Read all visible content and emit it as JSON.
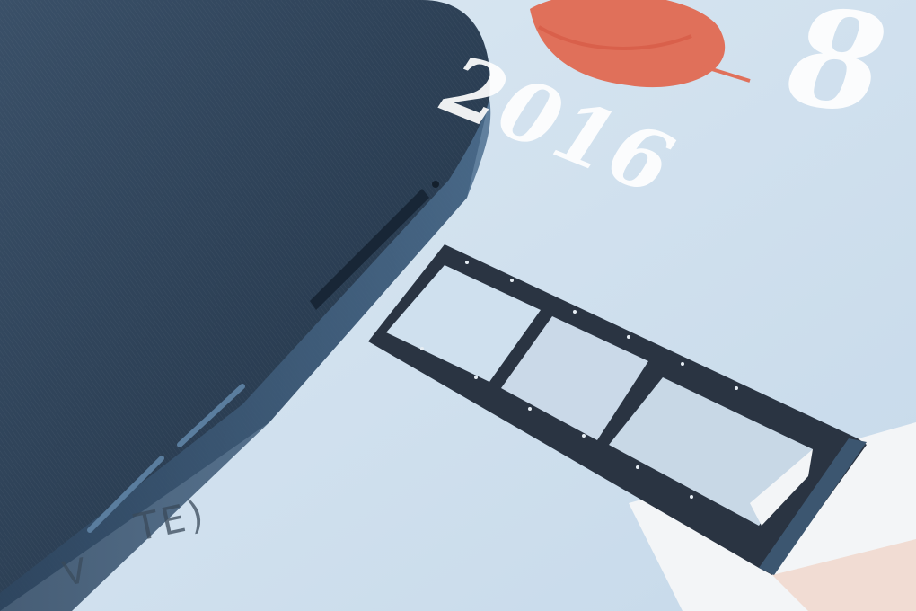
{
  "scene": {
    "description_colors": {
      "background": "#cfe0ee",
      "phone_body": "#2b3f55",
      "tray": "#2a3442",
      "accent_red": "#e0705a",
      "paper_white": "#f4f6f8"
    }
  },
  "printed_text": {
    "year_fragment": "2016",
    "large_glyph": "8",
    "card_text_line1": "TE)",
    "card_text_line2": "V"
  }
}
